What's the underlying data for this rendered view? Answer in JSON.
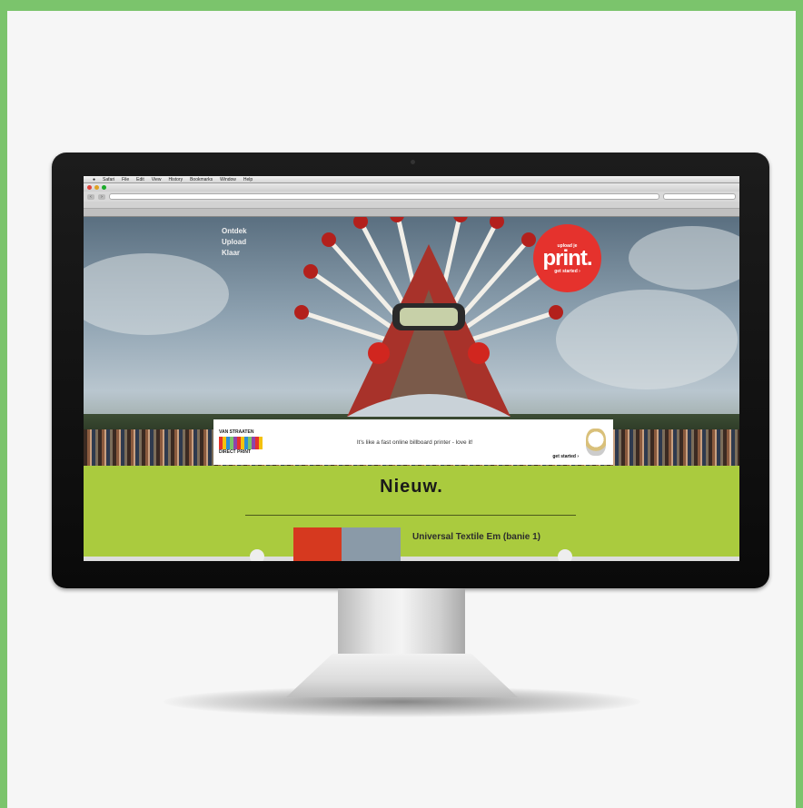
{
  "browser": {
    "menu_items": [
      "Safari",
      "File",
      "Edit",
      "View",
      "History",
      "Bookmarks",
      "Window",
      "Help"
    ],
    "url": "",
    "bookmarks": [],
    "tab_title": ""
  },
  "hero": {
    "text_lines": [
      "Ontdek",
      "Upload",
      "Klaar"
    ],
    "badge_small_top": "upload je",
    "badge_big": "print.",
    "badge_small_bottom": "get started ›"
  },
  "ad": {
    "brand": "VAN STRAATEN",
    "brand_sub": "DIRECT PRINT",
    "tagline": "It's like a fast online billboard printer - love it!",
    "cta": "get started ›"
  },
  "nieuw": {
    "title": "Nieuw.",
    "item_title": "Universal Textile Em (banie 1)"
  },
  "colors": {
    "outer_frame": "#7bc46c",
    "nieuw_bg": "#aacb3e",
    "badge_red": "#e5322d"
  }
}
